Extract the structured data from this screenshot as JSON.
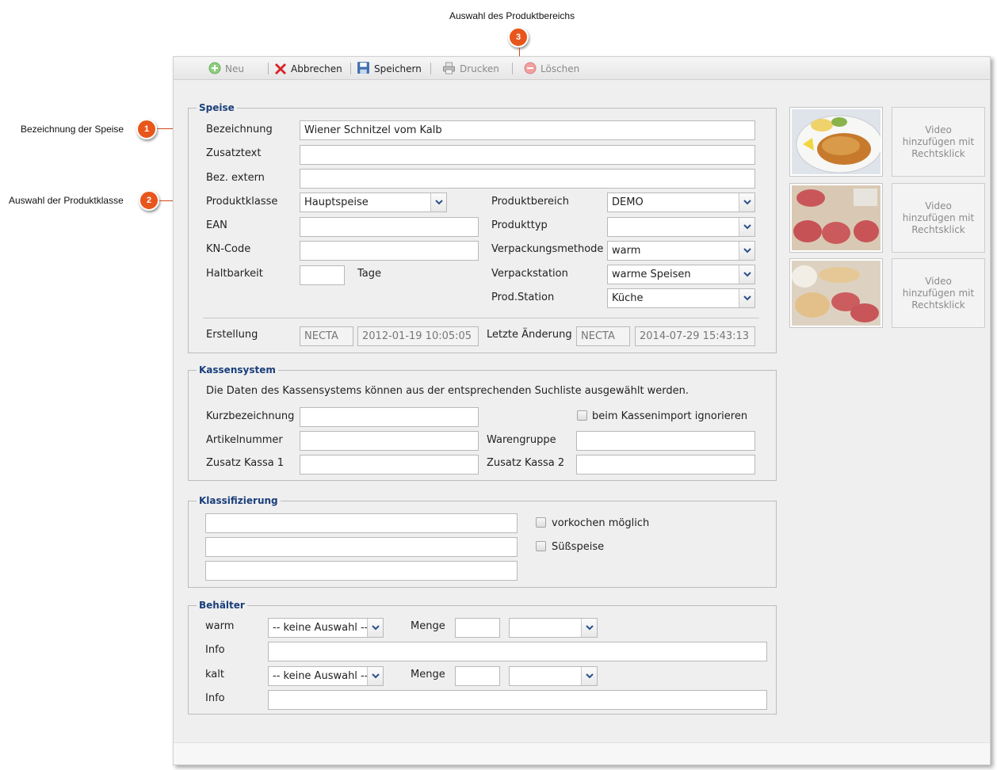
{
  "callouts": [
    {
      "number": "1",
      "text": "Bezeichnung der Speise"
    },
    {
      "number": "2",
      "text": "Auswahl der Produktklasse"
    },
    {
      "number": "3",
      "text": "Auswahl des Produktbereichs"
    }
  ],
  "toolbar": {
    "new_label": "Neu",
    "cancel_label": "Abbrechen",
    "save_label": "Speichern",
    "print_label": "Drucken",
    "delete_label": "Löschen"
  },
  "speise": {
    "legend": "Speise",
    "bezeichnung_label": "Bezeichnung",
    "bezeichnung_value": "Wiener Schnitzel vom Kalb",
    "zusatztext_label": "Zusatztext",
    "zusatztext_value": "",
    "bez_extern_label": "Bez. extern",
    "bez_extern_value": "",
    "produktklasse_label": "Produktklasse",
    "produktklasse_value": "Hauptspeise",
    "ean_label": "EAN",
    "ean_value": "",
    "kn_code_label": "KN-Code",
    "kn_code_value": "",
    "haltbarkeit_label": "Haltbarkeit",
    "haltbarkeit_value": "",
    "tage_label": "Tage",
    "produktbereich_label": "Produktbereich",
    "produktbereich_value": "DEMO",
    "produkttyp_label": "Produkttyp",
    "produkttyp_value": "",
    "verpackungsmethode_label": "Verpackungsmethode",
    "verpackungsmethode_value": "warm",
    "verpackstation_label": "Verpackstation",
    "verpackstation_value": "warme Speisen",
    "prodstation_label": "Prod.Station",
    "prodstation_value": "Küche",
    "erstellung_label": "Erstellung",
    "erstellung_user": "NECTA",
    "erstellung_date": "2012-01-19 10:05:05",
    "letzte_aenderung_label": "Letzte Änderung",
    "letzte_aenderung_user": "NECTA",
    "letzte_aenderung_date": "2014-07-29 15:43:13"
  },
  "media": {
    "video_text": "Video hinzufügen mit Rechtsklick"
  },
  "kassensystem": {
    "legend": "Kassensystem",
    "info_text": "Die Daten des Kassensystems können aus der entsprechenden Suchliste ausgewählt werden.",
    "kurzbezeichnung_label": "Kurzbezeichnung",
    "ignore_label": "beim Kassenimport ignorieren",
    "artikelnummer_label": "Artikelnummer",
    "warengruppe_label": "Warengruppe",
    "zusatz_kassa1_label": "Zusatz Kassa 1",
    "zusatz_kassa2_label": "Zusatz Kassa 2"
  },
  "klassifizierung": {
    "legend": "Klassifizierung",
    "vorkochen_label": "vorkochen möglich",
    "suessspeise_label": "Süßspeise"
  },
  "behaelter": {
    "legend": "Behälter",
    "warm_label": "warm",
    "kalt_label": "kalt",
    "info_label": "Info",
    "menge_label": "Menge",
    "keine_auswahl": "-- keine Auswahl --"
  },
  "colors": {
    "badge": "#e8561b",
    "legend_text": "#1a3f7a",
    "panel_bg": "#efefef"
  }
}
